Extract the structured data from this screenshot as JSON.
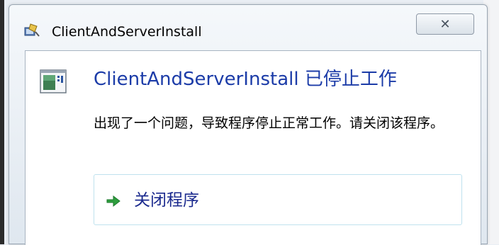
{
  "window": {
    "title": "ClientAndServerInstall",
    "close_glyph": "✕",
    "icon": "application-icon"
  },
  "dialog": {
    "heading": "ClientAndServerInstall 已停止工作",
    "message": "出现了一个问题，导致程序停止正常工作。请关闭该程序。",
    "program_icon": "program-window-icon"
  },
  "command": {
    "label": "关闭程序",
    "icon": "green-arrow-icon"
  },
  "colors": {
    "heading": "#1c3ca8",
    "command_text": "#1b2a8e",
    "arrow": "#2e9e3e",
    "command_border": "#bfe2ee"
  }
}
